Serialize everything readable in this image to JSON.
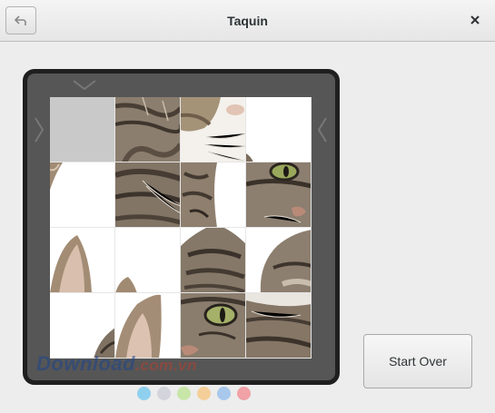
{
  "window": {
    "title": "Taquin"
  },
  "header": {
    "back_icon": "undo-arrow-icon",
    "close_icon": "close-icon"
  },
  "puzzle": {
    "rows": 4,
    "columns": 4,
    "empty_tile": {
      "row": 1,
      "column": 1
    },
    "tiles": [
      {
        "row": 1,
        "column": 1,
        "content": "empty"
      },
      {
        "row": 1,
        "column": 2,
        "content": "cat-forehead-fur"
      },
      {
        "row": 1,
        "column": 3,
        "content": "cat-nose-whiskers"
      },
      {
        "row": 1,
        "column": 4,
        "content": "white-background"
      },
      {
        "row": 2,
        "column": 1,
        "content": "cat-ear-edge"
      },
      {
        "row": 2,
        "column": 2,
        "content": "cat-cheek-fur"
      },
      {
        "row": 2,
        "column": 3,
        "content": "cat-face-side"
      },
      {
        "row": 2,
        "column": 4,
        "content": "cat-green-eye"
      },
      {
        "row": 3,
        "column": 1,
        "content": "cat-ear"
      },
      {
        "row": 3,
        "column": 2,
        "content": "white-background"
      },
      {
        "row": 3,
        "column": 3,
        "content": "cat-head-top"
      },
      {
        "row": 3,
        "column": 4,
        "content": "cat-muzzle"
      },
      {
        "row": 4,
        "column": 1,
        "content": "cat-neck-edge"
      },
      {
        "row": 4,
        "column": 2,
        "content": "cat-ear"
      },
      {
        "row": 4,
        "column": 3,
        "content": "cat-green-eye"
      },
      {
        "row": 4,
        "column": 4,
        "content": "cat-chin-fur"
      }
    ]
  },
  "watermark": {
    "text": "Download",
    "suffix": ".com.vn"
  },
  "page_dots": {
    "colors": [
      "#8fd0ef",
      "#d4d4dc",
      "#c8e6a8",
      "#f5cf9a",
      "#a8c8ec",
      "#f0a2a6"
    ]
  },
  "actions": {
    "start_over_label": "Start Over"
  }
}
